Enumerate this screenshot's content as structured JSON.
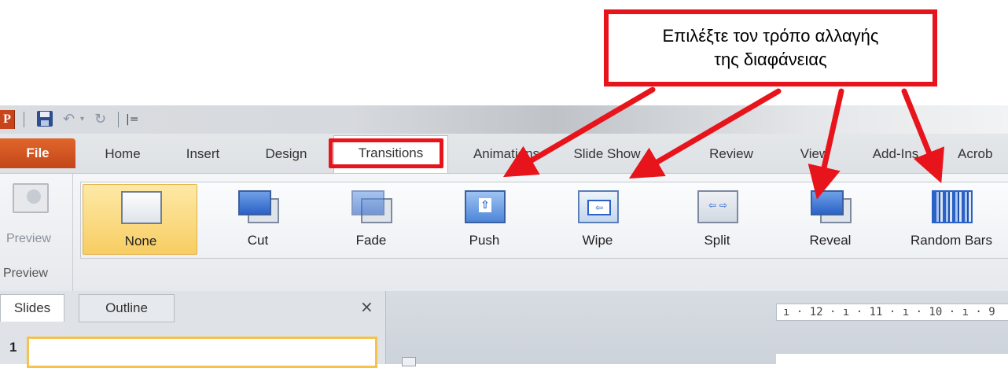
{
  "callout": {
    "line1": "Επιλέξτε τον τρόπο αλλαγής",
    "line2": "της διαφάνειας"
  },
  "qat": {
    "app_icon_letter": "P",
    "customize_glyph": "|="
  },
  "tabs": [
    {
      "label": "File"
    },
    {
      "label": "Home"
    },
    {
      "label": "Insert"
    },
    {
      "label": "Design"
    },
    {
      "label": "Transitions"
    },
    {
      "label": "Animations"
    },
    {
      "label": "Slide Show"
    },
    {
      "label": "Review"
    },
    {
      "label": "View"
    },
    {
      "label": "Add-Ins"
    },
    {
      "label": "Acrob"
    }
  ],
  "ribbon": {
    "preview_button": "Preview",
    "preview_group": "Preview",
    "gallery": [
      {
        "label": "None",
        "icon": "none-transition-icon",
        "selected": true
      },
      {
        "label": "Cut",
        "icon": "cut-transition-icon"
      },
      {
        "label": "Fade",
        "icon": "fade-transition-icon"
      },
      {
        "label": "Push",
        "icon": "push-transition-icon"
      },
      {
        "label": "Wipe",
        "icon": "wipe-transition-icon"
      },
      {
        "label": "Split",
        "icon": "split-transition-icon"
      },
      {
        "label": "Reveal",
        "icon": "reveal-transition-icon"
      },
      {
        "label": "Random Bars",
        "icon": "random-bars-transition-icon"
      }
    ]
  },
  "panel": {
    "tab_slides": "Slides",
    "tab_outline": "Outline",
    "close": "×",
    "slide_number": "1"
  },
  "editor": {
    "ruler_text": "ı · 12 · ı · 11 · ı · 10 · ı · 9"
  },
  "colors": {
    "highlight_red": "#e8141c",
    "file_tab": "#c4461a",
    "selected_gallery": "#f8cd63"
  }
}
